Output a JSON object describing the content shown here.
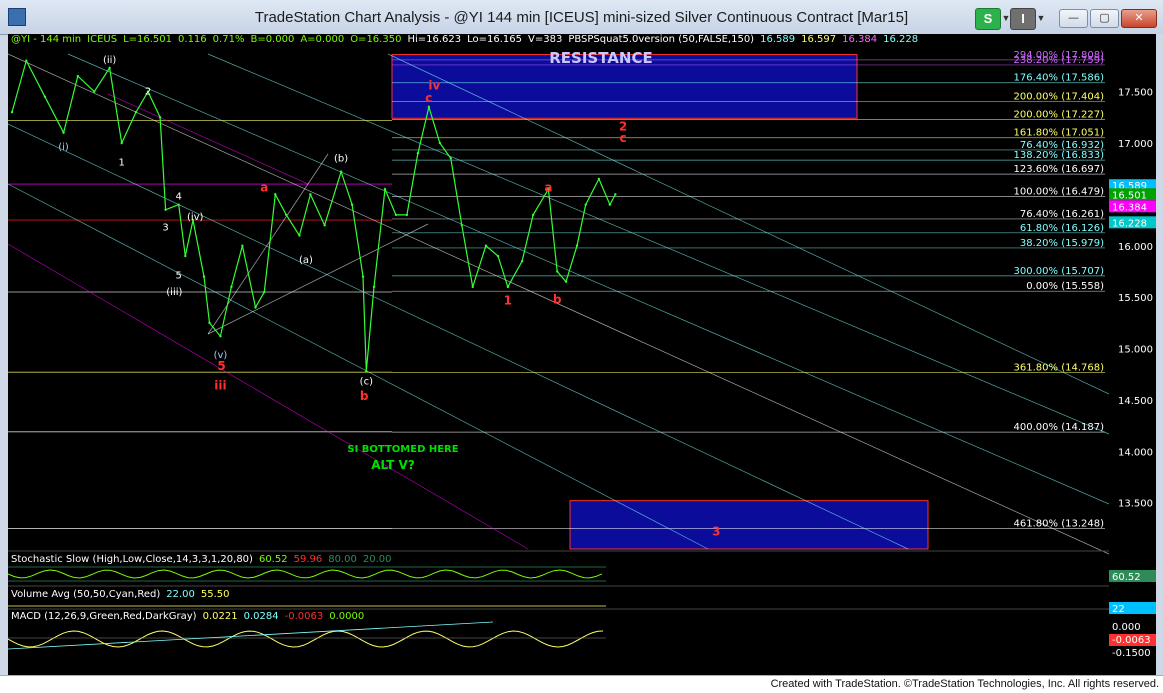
{
  "window": {
    "title": "TradeStation Chart Analysis - @YI 144 min [ICEUS] mini-sized Silver Continuous Contract [Mar15]",
    "s_button": "S",
    "i_button": "I",
    "min_glyph": "—",
    "max_glyph": "▢",
    "close_glyph": "✕"
  },
  "header": {
    "symbol": "@YI - 144 min",
    "exchange": "ICEUS",
    "last": "L=16.501",
    "change": "0.116",
    "pct": "0.71%",
    "bid": "B=0.000",
    "ask": "A=0.000",
    "open": "O=16.350",
    "high": "Hi=16.623",
    "low": "Lo=16.165",
    "volume": "V=383",
    "study": "PBSPSquat5.0version (50,FALSE,150)",
    "v1": "16.589",
    "v2": "16.597",
    "v3": "16.384",
    "v4": "16.228"
  },
  "indicators": {
    "stoch_title": "Stochastic Slow (High,Low,Close,14,3,3,1,20,80)",
    "stoch_v1": "60.52",
    "stoch_v2": "59.96",
    "stoch_v3": "80.00",
    "stoch_v4": "20.00",
    "vol_title": "Volume Avg (50,50,Cyan,Red)",
    "vol_v1": "22.00",
    "vol_v2": "55.50",
    "macd_title": "MACD (12,26,9,Green,Red,DarkGray)",
    "macd_v1": "0.0221",
    "macd_v2": "0.0284",
    "macd_v3": "-0.0063",
    "macd_v4": "0.0000"
  },
  "annotations": {
    "resistance": "RESISTANCE",
    "si_bottom": "SI BOTTOMED HERE",
    "alt_v": "ALT V?"
  },
  "fib_levels": [
    {
      "label": "294.00% (17.808)",
      "price": 17.808,
      "color": "#cc66ff"
    },
    {
      "label": "238.20% (17.759)",
      "price": 17.759,
      "color": "#cc66ff"
    },
    {
      "label": "176.40% (17.586)",
      "price": 17.586,
      "color": "#80ffff"
    },
    {
      "label": "200.00% (17.404)",
      "price": 17.404,
      "color": "#ffff66"
    },
    {
      "label": "200.00% (17.227)",
      "price": 17.227,
      "color": "#ffff66"
    },
    {
      "label": "161.80% (17.051)",
      "price": 17.051,
      "color": "#ffff66"
    },
    {
      "label": "76.40% (16.932)",
      "price": 16.932,
      "color": "#80ffff"
    },
    {
      "label": "138.20% (16.833)",
      "price": 16.833,
      "color": "#80ffff"
    },
    {
      "label": "123.60% (16.697)",
      "price": 16.697,
      "color": "#ffffff"
    },
    {
      "label": "100.00% (16.479)",
      "price": 16.479,
      "color": "#ffffff"
    },
    {
      "label": "76.40% (16.261)",
      "price": 16.261,
      "color": "#ffffff"
    },
    {
      "label": "61.80% (16.126)",
      "price": 16.126,
      "color": "#80ffff"
    },
    {
      "label": "38.20% (15.979)",
      "price": 15.979,
      "color": "#80ffff"
    },
    {
      "label": "300.00% (15.707)",
      "price": 15.707,
      "color": "#80ffff"
    },
    {
      "label": "0.00% (15.558)",
      "price": 15.558,
      "color": "#ffffff"
    },
    {
      "label": "361.80% (14.768)",
      "price": 14.768,
      "color": "#ffff66"
    },
    {
      "label": "400.00% (14.187)",
      "price": 14.187,
      "color": "#ffffff"
    },
    {
      "label": "461.80% (13.248)",
      "price": 13.248,
      "color": "#ffffff"
    }
  ],
  "wave_labels": [
    {
      "text": "(i)",
      "x": 0.047,
      "y": 16.93,
      "color": "#9ec8ff"
    },
    {
      "text": "(ii)",
      "x": 0.089,
      "y": 17.78,
      "color": "#ffffff"
    },
    {
      "text": "1",
      "x": 0.1,
      "y": 16.78,
      "color": "#ffffff"
    },
    {
      "text": "2",
      "x": 0.124,
      "y": 17.47,
      "color": "#ffffff"
    },
    {
      "text": "3",
      "x": 0.14,
      "y": 16.15,
      "color": "#ffffff"
    },
    {
      "text": "4",
      "x": 0.152,
      "y": 16.45,
      "color": "#ffffff"
    },
    {
      "text": "(iv)",
      "x": 0.167,
      "y": 16.25,
      "color": "#ffffff"
    },
    {
      "text": "5",
      "x": 0.152,
      "y": 15.68,
      "color": "#ffffff"
    },
    {
      "text": "(iii)",
      "x": 0.148,
      "y": 15.52,
      "color": "#ffffff"
    },
    {
      "text": "(v)",
      "x": 0.19,
      "y": 14.91,
      "color": "#9ec8ff"
    },
    {
      "text": "5",
      "x": 0.191,
      "y": 14.79,
      "color": "#ff3030"
    },
    {
      "text": "iii",
      "x": 0.19,
      "y": 14.6,
      "color": "#ff3030"
    },
    {
      "text": "a",
      "x": 0.23,
      "y": 16.53,
      "color": "#ff3030"
    },
    {
      "text": "(a)",
      "x": 0.268,
      "y": 15.83,
      "color": "#ffffff"
    },
    {
      "text": "(b)",
      "x": 0.3,
      "y": 16.82,
      "color": "#ffffff"
    },
    {
      "text": "(c)",
      "x": 0.323,
      "y": 14.65,
      "color": "#ffffff"
    },
    {
      "text": "b",
      "x": 0.321,
      "y": 14.5,
      "color": "#ff3030"
    },
    {
      "text": "iv",
      "x": 0.385,
      "y": 17.52,
      "color": "#ff3030"
    },
    {
      "text": "c",
      "x": 0.38,
      "y": 17.4,
      "color": "#ff3030"
    },
    {
      "text": "2",
      "x": 0.557,
      "y": 17.12,
      "color": "#ff3030"
    },
    {
      "text": "c",
      "x": 0.557,
      "y": 17.01,
      "color": "#ff3030"
    },
    {
      "text": "a",
      "x": 0.489,
      "y": 16.53,
      "color": "#ff3030"
    },
    {
      "text": "1",
      "x": 0.452,
      "y": 15.43,
      "color": "#ff3030"
    },
    {
      "text": "b",
      "x": 0.497,
      "y": 15.44,
      "color": "#ff3030"
    },
    {
      "text": "3",
      "x": 0.642,
      "y": 13.18,
      "color": "#ff3030"
    }
  ],
  "price_axis": {
    "ticks": [
      "17.500",
      "17.000",
      "16.500",
      "16.000",
      "15.500",
      "15.000",
      "14.500",
      "14.000",
      "13.500"
    ],
    "tags": [
      {
        "text": "16.589",
        "price": 16.589,
        "bg": "#00bfff"
      },
      {
        "text": "16.501",
        "price": 16.501,
        "bg": "#00a000"
      },
      {
        "text": "16.384",
        "price": 16.384,
        "bg": "#ff00ff"
      },
      {
        "text": "16.228",
        "price": 16.228,
        "bg": "#00c8c8"
      }
    ],
    "stoch_tag": "60.52",
    "vol_tag": "22",
    "macd_tags": [
      "0.000",
      "-0.0063",
      "-0.1500"
    ]
  },
  "footer": "Created with TradeStation. ©TradeStation Technologies, Inc. All rights reserved.",
  "chart_data": {
    "type": "line",
    "title": "@YI 144 min mini-sized Silver Continuous Contract [Mar15]",
    "ylabel": "",
    "ylim": [
      13.0,
      18.0
    ],
    "series": [
      {
        "name": "@YI - 144 min",
        "points": [
          [
            0,
            17.3
          ],
          [
            0.013,
            17.8
          ],
          [
            0.03,
            17.45
          ],
          [
            0.047,
            17.1
          ],
          [
            0.06,
            17.65
          ],
          [
            0.075,
            17.5
          ],
          [
            0.089,
            17.73
          ],
          [
            0.1,
            17.0
          ],
          [
            0.113,
            17.3
          ],
          [
            0.124,
            17.5
          ],
          [
            0.135,
            17.25
          ],
          [
            0.14,
            16.35
          ],
          [
            0.152,
            16.4
          ],
          [
            0.158,
            15.9
          ],
          [
            0.165,
            16.25
          ],
          [
            0.175,
            15.7
          ],
          [
            0.18,
            15.25
          ],
          [
            0.19,
            15.12
          ],
          [
            0.2,
            15.6
          ],
          [
            0.21,
            16.0
          ],
          [
            0.222,
            15.4
          ],
          [
            0.23,
            15.55
          ],
          [
            0.24,
            16.5
          ],
          [
            0.25,
            16.3
          ],
          [
            0.262,
            16.1
          ],
          [
            0.272,
            16.5
          ],
          [
            0.285,
            16.2
          ],
          [
            0.3,
            16.72
          ],
          [
            0.31,
            16.4
          ],
          [
            0.32,
            15.7
          ],
          [
            0.323,
            14.78
          ],
          [
            0.33,
            15.6
          ],
          [
            0.34,
            16.55
          ],
          [
            0.35,
            16.3
          ],
          [
            0.36,
            16.3
          ],
          [
            0.37,
            16.9
          ],
          [
            0.38,
            17.35
          ],
          [
            0.39,
            17.0
          ],
          [
            0.4,
            16.85
          ],
          [
            0.41,
            16.2
          ],
          [
            0.42,
            15.6
          ],
          [
            0.432,
            16.0
          ],
          [
            0.443,
            15.9
          ],
          [
            0.452,
            15.6
          ],
          [
            0.465,
            15.85
          ],
          [
            0.475,
            16.3
          ],
          [
            0.489,
            16.55
          ],
          [
            0.497,
            15.75
          ],
          [
            0.505,
            15.65
          ],
          [
            0.515,
            16.0
          ],
          [
            0.523,
            16.4
          ],
          [
            0.535,
            16.65
          ],
          [
            0.545,
            16.4
          ],
          [
            0.55,
            16.5
          ]
        ]
      }
    ],
    "zones": [
      {
        "name": "RESISTANCE",
        "from": 17.24,
        "to": 17.86
      },
      {
        "name": "3",
        "from": 12.9,
        "to": 13.52
      }
    ]
  }
}
